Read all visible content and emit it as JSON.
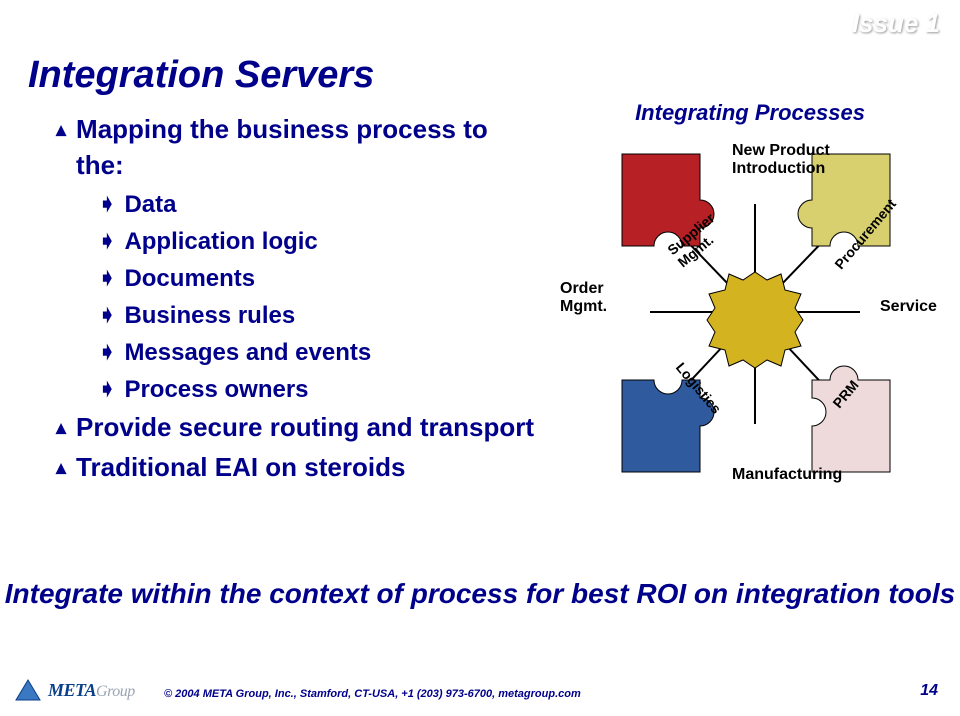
{
  "issue_badge": "Issue 1",
  "title": "Integration Servers",
  "bullets": [
    {
      "level": 1,
      "text": "Mapping the business process to the:"
    },
    {
      "level": 2,
      "text": "Data"
    },
    {
      "level": 2,
      "text": "Application logic"
    },
    {
      "level": 2,
      "text": "Documents"
    },
    {
      "level": 2,
      "text": "Business rules"
    },
    {
      "level": 2,
      "text": "Messages and events"
    },
    {
      "level": 2,
      "text": "Process owners"
    },
    {
      "level": 1,
      "text": "Provide secure routing and transport"
    },
    {
      "level": 1,
      "text": "Traditional EAI on steroids"
    }
  ],
  "summary": "Integrate within the context of process for best ROI on integration tools",
  "diagram": {
    "title": "Integrating Processes",
    "labels": {
      "npi_line1": "New Product",
      "npi_line2": "Introduction",
      "order_line1": "Order",
      "order_line2": "Mgmt.",
      "service": "Service",
      "mfg": "Manufacturing",
      "supplier_line1": "Supplier",
      "supplier_line2": "Mgmt.",
      "procurement": "Procurement",
      "logistics": "Logistics",
      "prm": "PRM"
    },
    "corner_colors": {
      "tl": "#b72025",
      "tr": "#d8d06e",
      "bl": "#2f5a9e",
      "br": "#eedada"
    },
    "gear_color": "#d3b31f"
  },
  "footer": {
    "logo_main": "META",
    "logo_sub": "Group",
    "copyright": "© 2004 META Group, Inc., Stamford, CT-USA, +1 (203) 973-6700, metagroup.com",
    "pagenum": "14"
  }
}
